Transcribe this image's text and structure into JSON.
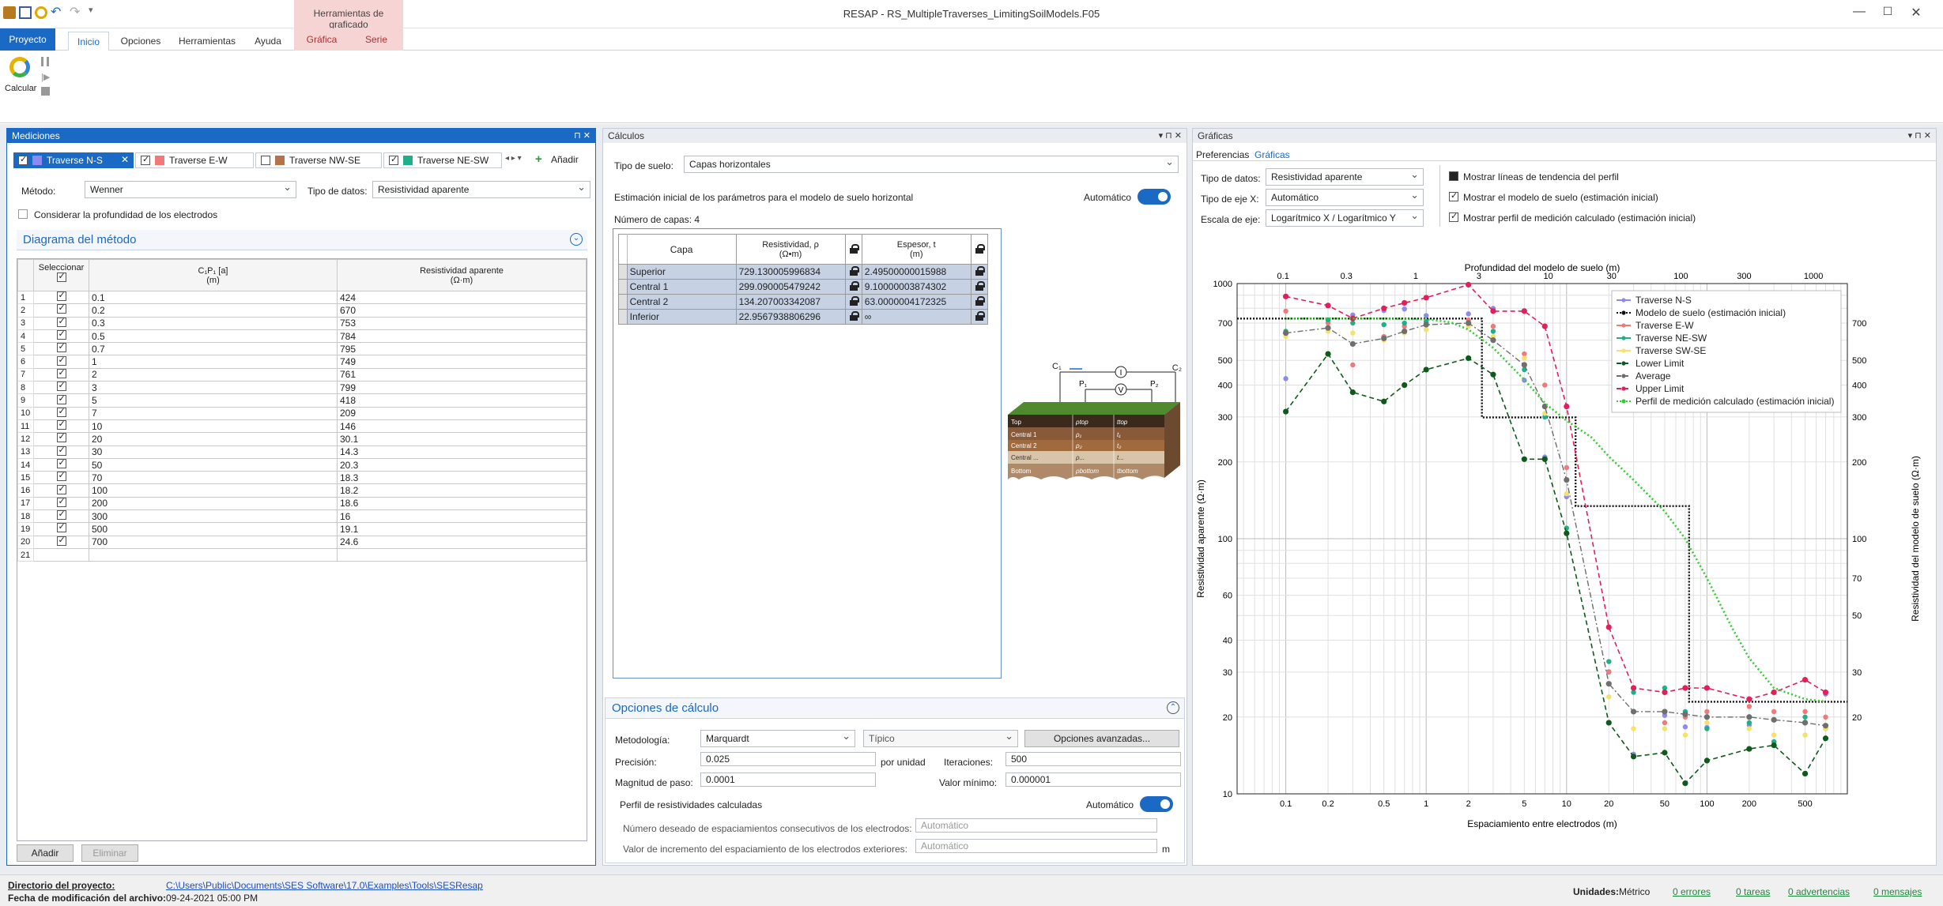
{
  "app": {
    "title": "RESAP - RS_MultipleTraverses_LimitingSoilModels.F05",
    "context_header": "Herramientas de graficado"
  },
  "tabs": [
    "Proyecto",
    "Inicio",
    "Opciones",
    "Herramientas",
    "Ayuda",
    "Gráfica",
    "Serie"
  ],
  "ribbon": {
    "calc_label": "Calcular"
  },
  "mediciones": {
    "title": "Mediciones",
    "traverses": [
      {
        "label": "Traverse N-S",
        "color": "#8b8bef",
        "checked": true,
        "active": true
      },
      {
        "label": "Traverse E-W",
        "color": "#f07a7a",
        "checked": true
      },
      {
        "label": "Traverse NW-SE",
        "color": "#b5734a",
        "checked": false
      },
      {
        "label": "Traverse NE-SW",
        "color": "#1fb08a",
        "checked": true
      }
    ],
    "add_label": "Añadir",
    "method_label": "Método:",
    "method_value": "Wenner",
    "datatype_label": "Tipo de datos:",
    "datatype_value": "Resistividad aparente",
    "depth_label": "Considerar la profundidad de los electrodos",
    "diagram_label": "Diagrama del método",
    "col_select": "Seleccionar",
    "col_spacing": "C₁P₁ [a]",
    "col_spacing_unit": "(m)",
    "col_res": "Resistividad aparente",
    "col_res_unit": "(Ω·m)",
    "rows": [
      [
        "1",
        "0.1",
        "424"
      ],
      [
        "2",
        "0.2",
        "670"
      ],
      [
        "3",
        "0.3",
        "753"
      ],
      [
        "4",
        "0.5",
        "784"
      ],
      [
        "5",
        "0.7",
        "795"
      ],
      [
        "6",
        "1",
        "749"
      ],
      [
        "7",
        "2",
        "761"
      ],
      [
        "8",
        "3",
        "799"
      ],
      [
        "9",
        "5",
        "418"
      ],
      [
        "10",
        "7",
        "209"
      ],
      [
        "11",
        "10",
        "146"
      ],
      [
        "12",
        "20",
        "30.1"
      ],
      [
        "13",
        "30",
        "14.3"
      ],
      [
        "14",
        "50",
        "20.3"
      ],
      [
        "15",
        "70",
        "18.3"
      ],
      [
        "16",
        "100",
        "18.2"
      ],
      [
        "17",
        "200",
        "18.6"
      ],
      [
        "18",
        "300",
        "16"
      ],
      [
        "19",
        "500",
        "19.1"
      ],
      [
        "20",
        "700",
        "24.6"
      ]
    ],
    "last_row": "21",
    "btn_add": "Añadir",
    "btn_delete": "Eliminar"
  },
  "calculos": {
    "title": "Cálculos",
    "soiltype_label": "Tipo de suelo:",
    "soiltype_value": "Capas horizontales",
    "estimation_label": "Estimación inicial de los parámetros para el modelo de suelo horizontal",
    "auto_label": "Automático",
    "layers_label": "Número de capas: 4",
    "col_layer": "Capa",
    "col_res": "Resistividad, ρ",
    "col_res_unit": "(Ω•m)",
    "col_thk": "Espesor, t",
    "col_thk_unit": "(m)",
    "layers": [
      [
        "Superior",
        "729.130005996834",
        "2.49500000015988"
      ],
      [
        "Central 1",
        "299.090005479242",
        "9.10000003874302"
      ],
      [
        "Central 2",
        "134.207003342087",
        "63.0000004172325"
      ],
      [
        "Inferior",
        "22.9567938806296",
        "∞"
      ]
    ],
    "diagram": {
      "c1": "C₁",
      "c2": "C₂",
      "p1": "P₁",
      "p2": "P₂",
      "i": "I",
      "v": "V",
      "top": "Top",
      "central1": "Central 1",
      "central2": "Central 2",
      "central_n": "Central ...",
      "bottom": "Bottom",
      "rho_top": "ρtop",
      "rho1": "ρ₁",
      "rho2": "ρ₂",
      "rho_n": "ρ...",
      "rho_bottom": "ρbottom",
      "t_top": "ttop",
      "t1": "t₁",
      "t2": "t₂",
      "t_n": "t...",
      "t_bottom": "tbottom"
    },
    "options_title": "Opciones de cálculo",
    "method_label": "Metodología:",
    "method_value": "Marquardt",
    "mode_value": "Típico",
    "advanced_btn": "Opciones avanzadas...",
    "precision_label": "Precisión:",
    "precision_value": "0.025",
    "per_unit": "por unidad",
    "iter_label": "Iteraciones:",
    "iter_value": "500",
    "step_label": "Magnitud de paso:",
    "step_value": "0.0001",
    "minval_label": "Valor mínimo:",
    "minval_value": "0.000001",
    "profile_label": "Perfil de resistividades calculadas",
    "auto2_label": "Automático",
    "spacings_label": "Número deseado de espaciamientos consecutivos de los electrodos:",
    "spacings_value": "Automático",
    "increment_label": "Valor de incremento del espaciamiento de los electrodos exteriores:",
    "increment_value": "Automático",
    "increment_unit": "m"
  },
  "graficas": {
    "title": "Gráficas",
    "tab_prefs": "Preferencias",
    "tab_graphs": "Gráficas",
    "datatype_label": "Tipo de datos:",
    "datatype_value": "Resistividad aparente",
    "xaxis_label": "Tipo de eje X:",
    "xaxis_value": "Automático",
    "scale_label": "Escala de eje:",
    "scale_value": "Logarítmico X / Logarítmico Y",
    "chk_trend": "Mostrar líneas de tendencia del perfil",
    "chk_model": "Mostrar el modelo de suelo (estimación inicial)",
    "chk_profile": "Mostrar perfil de medición calculado (estimación inicial)"
  },
  "chart_data": {
    "type": "line",
    "x_scale": "log",
    "y_scale": "log",
    "xlabel": "Espaciamiento entre electrodos (m)",
    "x2label": "Profundidad del modelo de suelo (m)",
    "ylabel": "Resistividad aparente (Ω·m)",
    "y2label": "Resistividad del modelo de suelo (Ω·m)",
    "xlim": [
      0.045,
      1000
    ],
    "ylim": [
      10,
      1000
    ],
    "x_ticks": [
      "0.1",
      "0.2",
      "0.5",
      "1",
      "2",
      "5",
      "10",
      "20",
      "50",
      "100",
      "200",
      "500"
    ],
    "x2_ticks": [
      "0.1",
      "0.3",
      "1",
      "3",
      "10",
      "30",
      "100",
      "300",
      "1000"
    ],
    "y_ticks": [
      "1000",
      "700",
      "500",
      "400",
      "300",
      "200",
      "100",
      "60",
      "40",
      "30",
      "20",
      "10"
    ],
    "y2_ticks": [
      "700",
      "500",
      "400",
      "300",
      "200",
      "100",
      "70",
      "50",
      "30",
      "20"
    ],
    "legend_position": "top-right",
    "series": [
      {
        "name": "Traverse N-S",
        "color": "#8b8bef",
        "style": "points",
        "points": [
          [
            0.1,
            424
          ],
          [
            0.2,
            670
          ],
          [
            0.3,
            753
          ],
          [
            0.5,
            784
          ],
          [
            0.7,
            795
          ],
          [
            1,
            749
          ],
          [
            2,
            761
          ],
          [
            3,
            799
          ],
          [
            5,
            418
          ],
          [
            7,
            209
          ],
          [
            10,
            146
          ],
          [
            20,
            30.1
          ],
          [
            30,
            14.3
          ],
          [
            50,
            20.3
          ],
          [
            70,
            18.3
          ],
          [
            100,
            18.2
          ],
          [
            200,
            18.6
          ],
          [
            300,
            16
          ],
          [
            500,
            19.1
          ],
          [
            700,
            24.6
          ]
        ]
      },
      {
        "name": "Modelo de suelo (estimación inicial)",
        "color": "#111111",
        "style": "dotted-step",
        "points": [
          [
            0.045,
            729
          ],
          [
            2.495,
            729
          ],
          [
            2.495,
            299
          ],
          [
            11.595,
            299
          ],
          [
            11.595,
            134.2
          ],
          [
            74.6,
            134.2
          ],
          [
            74.6,
            22.96
          ],
          [
            1000,
            22.96
          ]
        ]
      },
      {
        "name": "Traverse E-W",
        "color": "#f07a7a",
        "style": "points",
        "points": [
          [
            0.1,
            780
          ],
          [
            0.2,
            700
          ],
          [
            0.3,
            480
          ],
          [
            0.5,
            620
          ],
          [
            0.7,
            680
          ],
          [
            1,
            700
          ],
          [
            2,
            720
          ],
          [
            3,
            680
          ],
          [
            5,
            530
          ],
          [
            7,
            400
          ],
          [
            10,
            190
          ],
          [
            20,
            30
          ],
          [
            30,
            21
          ],
          [
            50,
            19
          ],
          [
            70,
            20
          ],
          [
            100,
            21
          ],
          [
            200,
            22
          ],
          [
            300,
            21
          ],
          [
            500,
            21
          ],
          [
            700,
            20
          ]
        ]
      },
      {
        "name": "Traverse NE-SW",
        "color": "#1fb08a",
        "style": "points",
        "points": [
          [
            0.1,
            650
          ],
          [
            0.2,
            720
          ],
          [
            0.3,
            700
          ],
          [
            0.5,
            690
          ],
          [
            0.7,
            700
          ],
          [
            1,
            710
          ],
          [
            2,
            700
          ],
          [
            3,
            650
          ],
          [
            5,
            460
          ],
          [
            7,
            300
          ],
          [
            10,
            110
          ],
          [
            20,
            33
          ],
          [
            30,
            25
          ],
          [
            50,
            26
          ],
          [
            70,
            21
          ],
          [
            100,
            18
          ],
          [
            200,
            19
          ],
          [
            300,
            16
          ],
          [
            500,
            20
          ],
          [
            700,
            18
          ]
        ]
      },
      {
        "name": "Traverse SW-SE",
        "color": "#f5e26a",
        "style": "points",
        "points": [
          [
            0.1,
            620
          ],
          [
            0.2,
            650
          ],
          [
            0.3,
            640
          ],
          [
            0.5,
            600
          ],
          [
            0.7,
            640
          ],
          [
            1,
            660
          ],
          [
            2,
            680
          ],
          [
            3,
            620
          ],
          [
            5,
            510
          ],
          [
            7,
            310
          ],
          [
            10,
            150
          ],
          [
            20,
            24
          ],
          [
            30,
            18
          ],
          [
            50,
            18
          ],
          [
            70,
            17
          ],
          [
            100,
            19
          ],
          [
            200,
            18
          ],
          [
            300,
            17
          ],
          [
            500,
            17
          ],
          [
            700,
            18
          ]
        ]
      },
      {
        "name": "Lower Limit",
        "color": "#0e5a1d",
        "style": "dashed-dots",
        "points": [
          [
            0.1,
            315
          ],
          [
            0.2,
            530
          ],
          [
            0.3,
            375
          ],
          [
            0.5,
            345
          ],
          [
            0.7,
            400
          ],
          [
            1,
            460
          ],
          [
            2,
            510
          ],
          [
            3,
            440
          ],
          [
            5,
            205
          ],
          [
            7,
            205
          ],
          [
            10,
            105
          ],
          [
            20,
            19
          ],
          [
            30,
            14
          ],
          [
            50,
            14.5
          ],
          [
            70,
            11
          ],
          [
            100,
            13.5
          ],
          [
            200,
            15
          ],
          [
            300,
            15.5
          ],
          [
            500,
            12
          ],
          [
            700,
            16.5
          ]
        ]
      },
      {
        "name": "Average",
        "color": "#6e6e6e",
        "style": "dashdot-dots",
        "points": [
          [
            0.1,
            640
          ],
          [
            0.2,
            670
          ],
          [
            0.3,
            580
          ],
          [
            0.5,
            610
          ],
          [
            0.7,
            650
          ],
          [
            1,
            690
          ],
          [
            2,
            700
          ],
          [
            3,
            600
          ],
          [
            5,
            480
          ],
          [
            7,
            330
          ],
          [
            10,
            170
          ],
          [
            20,
            27
          ],
          [
            30,
            21
          ],
          [
            50,
            21
          ],
          [
            70,
            20.5
          ],
          [
            100,
            20
          ],
          [
            200,
            20
          ],
          [
            300,
            19.5
          ],
          [
            500,
            19
          ],
          [
            700,
            18.5
          ]
        ]
      },
      {
        "name": "Upper Limit",
        "color": "#e0205b",
        "style": "dashed-dots",
        "points": [
          [
            0.1,
            890
          ],
          [
            0.2,
            820
          ],
          [
            0.3,
            730
          ],
          [
            0.5,
            800
          ],
          [
            0.7,
            840
          ],
          [
            1,
            880
          ],
          [
            2,
            990
          ],
          [
            3,
            780
          ],
          [
            5,
            780
          ],
          [
            7,
            680
          ],
          [
            10,
            330
          ],
          [
            20,
            45
          ],
          [
            30,
            26
          ],
          [
            50,
            25
          ],
          [
            70,
            26
          ],
          [
            100,
            26
          ],
          [
            200,
            23.5
          ],
          [
            300,
            25
          ],
          [
            500,
            28
          ],
          [
            700,
            25
          ]
        ]
      },
      {
        "name": "Perfil de medición calculado (estimación inicial)",
        "color": "#33cc33",
        "style": "dotted",
        "points": [
          [
            0.1,
            729
          ],
          [
            0.5,
            729
          ],
          [
            1,
            725
          ],
          [
            1.5,
            705
          ],
          [
            2,
            660
          ],
          [
            3,
            560
          ],
          [
            5,
            420
          ],
          [
            7,
            340
          ],
          [
            10,
            290
          ],
          [
            15,
            250
          ],
          [
            20,
            210
          ],
          [
            30,
            170
          ],
          [
            50,
            128
          ],
          [
            70,
            100
          ],
          [
            100,
            70
          ],
          [
            150,
            45
          ],
          [
            200,
            34
          ],
          [
            300,
            26
          ],
          [
            500,
            23.5
          ],
          [
            700,
            23
          ]
        ]
      }
    ]
  },
  "status": {
    "dir_label": "Directorio del proyecto:",
    "dir_value": "C:\\Users\\Public\\Documents\\SES Software\\17.0\\Examples\\Tools\\SESResap",
    "mod_label": "Fecha de modificación del archivo:",
    "mod_value": "09-24-2021 05:00 PM",
    "units_label": "Unidades:",
    "units_value": "Métrico",
    "errors": "0 errores",
    "tasks": "0 tareas",
    "warnings": "0 advertencias",
    "messages": "0 mensajes"
  }
}
